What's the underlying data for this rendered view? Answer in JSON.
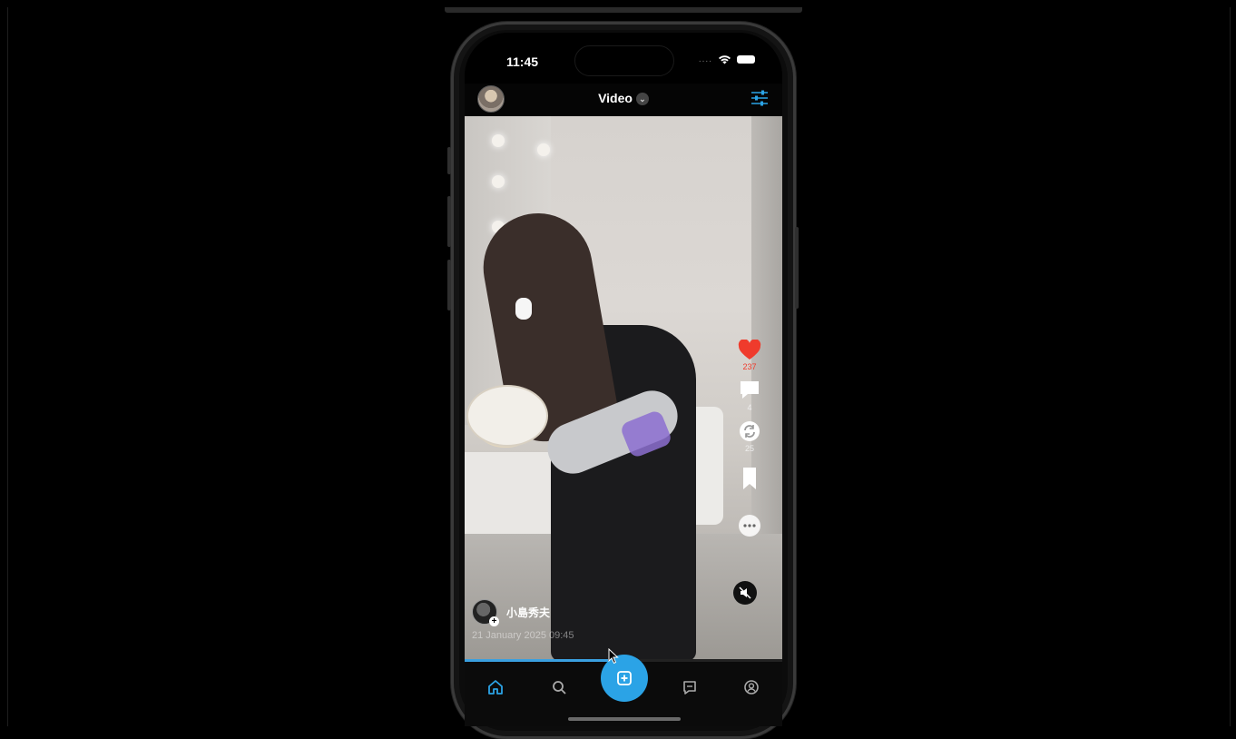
{
  "status_bar": {
    "time": "11:45",
    "signal_dots": "....",
    "icons": [
      "wifi-icon",
      "battery-icon"
    ]
  },
  "header": {
    "avatar": "user-avatar",
    "title": "Video",
    "title_chevron": "chevron-down-icon",
    "filter_icon": "sliders-icon"
  },
  "video": {
    "actions": {
      "like_count": "237",
      "comment_count": "4",
      "repost_count": "25",
      "icons": [
        "heart-icon",
        "comment-icon",
        "repost-icon",
        "bookmark-icon",
        "more-icon",
        "mute-icon"
      ]
    },
    "author": {
      "name": "小島秀夫",
      "follow_badge": "+"
    },
    "post_date": "21 January 2025 09:45",
    "progress_fraction": 0.45
  },
  "tab_bar": {
    "tabs": [
      "home-icon",
      "search-icon",
      "compose-icon",
      "messages-icon",
      "profile-icon"
    ],
    "active": "home-icon"
  },
  "colors": {
    "accent": "#2ba3e6",
    "like": "#ef3b2c",
    "background": "#000000"
  }
}
